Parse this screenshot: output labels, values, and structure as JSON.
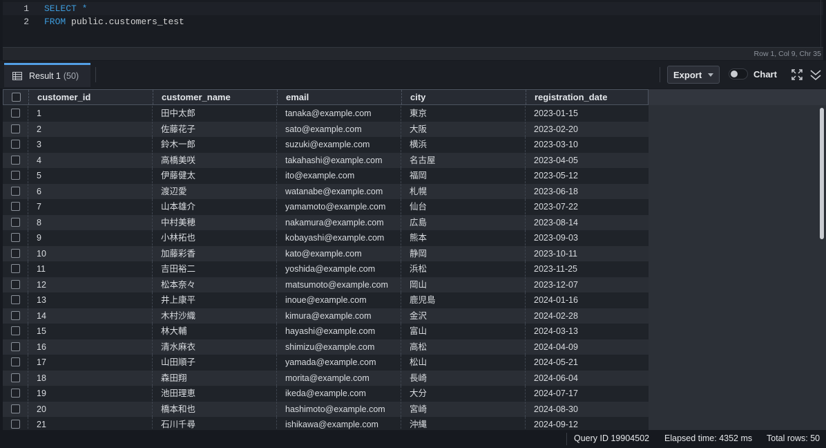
{
  "editor": {
    "lines": [
      {
        "num": "1",
        "keyword": "SELECT",
        "rest": " *"
      },
      {
        "num": "2",
        "keyword": "FROM",
        "rest": " public.customers_test"
      }
    ],
    "cursor_status": "Row 1,  Col 9,  Chr 35"
  },
  "result": {
    "tab_title": "Result 1",
    "tab_count": "(50)",
    "export_label": "Export",
    "chart_label": "Chart",
    "chart_toggle_on": false
  },
  "table": {
    "columns": [
      "customer_id",
      "customer_name",
      "email",
      "city",
      "registration_date"
    ],
    "rows": [
      [
        "1",
        "田中太郎",
        "tanaka@example.com",
        "東京",
        "2023-01-15"
      ],
      [
        "2",
        "佐藤花子",
        "sato@example.com",
        "大阪",
        "2023-02-20"
      ],
      [
        "3",
        "鈴木一郎",
        "suzuki@example.com",
        "横浜",
        "2023-03-10"
      ],
      [
        "4",
        "高橋美咲",
        "takahashi@example.com",
        "名古屋",
        "2023-04-05"
      ],
      [
        "5",
        "伊藤健太",
        "ito@example.com",
        "福岡",
        "2023-05-12"
      ],
      [
        "6",
        "渡辺愛",
        "watanabe@example.com",
        "札幌",
        "2023-06-18"
      ],
      [
        "7",
        "山本雄介",
        "yamamoto@example.com",
        "仙台",
        "2023-07-22"
      ],
      [
        "8",
        "中村美穂",
        "nakamura@example.com",
        "広島",
        "2023-08-14"
      ],
      [
        "9",
        "小林拓也",
        "kobayashi@example.com",
        "熊本",
        "2023-09-03"
      ],
      [
        "10",
        "加藤彩香",
        "kato@example.com",
        "静岡",
        "2023-10-11"
      ],
      [
        "11",
        "吉田裕二",
        "yoshida@example.com",
        "浜松",
        "2023-11-25"
      ],
      [
        "12",
        "松本奈々",
        "matsumoto@example.com",
        "岡山",
        "2023-12-07"
      ],
      [
        "13",
        "井上康平",
        "inoue@example.com",
        "鹿児島",
        "2024-01-16"
      ],
      [
        "14",
        "木村沙織",
        "kimura@example.com",
        "金沢",
        "2024-02-28"
      ],
      [
        "15",
        "林大輔",
        "hayashi@example.com",
        "富山",
        "2024-03-13"
      ],
      [
        "16",
        "清水麻衣",
        "shimizu@example.com",
        "高松",
        "2024-04-09"
      ],
      [
        "17",
        "山田順子",
        "yamada@example.com",
        "松山",
        "2024-05-21"
      ],
      [
        "18",
        "森田翔",
        "morita@example.com",
        "長崎",
        "2024-06-04"
      ],
      [
        "19",
        "池田理恵",
        "ikeda@example.com",
        "大分",
        "2024-07-17"
      ],
      [
        "20",
        "橋本和也",
        "hashimoto@example.com",
        "宮崎",
        "2024-08-30"
      ],
      [
        "21",
        "石川千尋",
        "ishikawa@example.com",
        "沖縄",
        "2024-09-12"
      ]
    ]
  },
  "footer": {
    "query_id": "Query ID 19904502",
    "elapsed": "Elapsed time: 4352 ms",
    "total_rows": "Total rows: 50"
  },
  "colors": {
    "accent": "#539fe5",
    "keyword": "#3d9bdc",
    "background": "#16191f"
  },
  "icons": [
    "table-grid-icon",
    "caret-down-icon",
    "expand-icon",
    "collapse-chevrons-icon"
  ]
}
